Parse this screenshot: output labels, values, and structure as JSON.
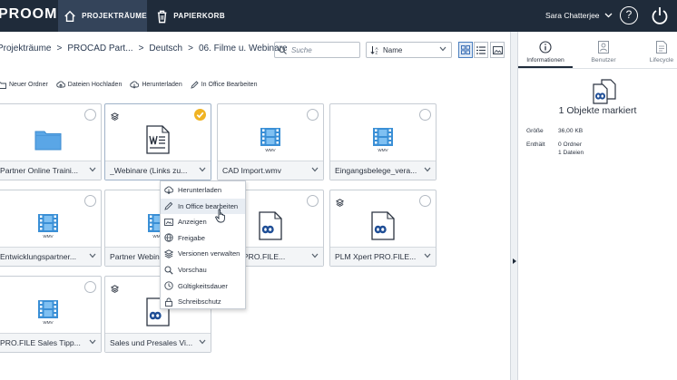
{
  "app": {
    "logo_text": "PROOM"
  },
  "topnav": {
    "tabs": [
      {
        "label": "PROJEKTRÄUME",
        "icon": "home-icon",
        "active": true
      },
      {
        "label": "PAPIERKORB",
        "icon": "trash-icon",
        "active": false
      }
    ],
    "user_name": "Sara Chatterjee",
    "help_label": "?"
  },
  "breadcrumb": [
    "Projekträume",
    "PROCAD Part...",
    "Deutsch",
    "06. Filme u. Webinare"
  ],
  "search": {
    "placeholder": "Suche"
  },
  "sort": {
    "label": "Name"
  },
  "actions": [
    {
      "label": "Neuer Ordner",
      "icon": "folder-plus-icon"
    },
    {
      "label": "Dateien Hochladen",
      "icon": "upload-icon"
    },
    {
      "label": "Herunterladen",
      "icon": "download-icon"
    },
    {
      "label": "In Office Bearbeiten",
      "icon": "pencil-icon"
    }
  ],
  "tiles": [
    {
      "name": "Partner Online Traini...",
      "type": "folder",
      "checked": false,
      "badge": false
    },
    {
      "name": "_Webinare (Links zu...",
      "type": "word",
      "checked": true,
      "badge": true
    },
    {
      "name": "CAD Import.wmv",
      "type": "wmv",
      "checked": false,
      "badge": false
    },
    {
      "name": "Eingangsbelege_vera...",
      "type": "wmv",
      "checked": false,
      "badge": false
    },
    {
      "name": "Entwicklungspartner...",
      "type": "wmv",
      "checked": false,
      "badge": false
    },
    {
      "name": "Partner Webinar...",
      "type": "wmv",
      "checked": false,
      "badge": false
    },
    {
      "name": "Xpert PRO.FILE...",
      "type": "proom",
      "checked": false,
      "badge": false
    },
    {
      "name": "PLM Xpert PRO.FILE...",
      "type": "proom",
      "checked": false,
      "badge": true
    },
    {
      "name": "PRO.FILE Sales Tipp...",
      "type": "wmv",
      "checked": false,
      "badge": false
    },
    {
      "name": "Sales und Presales Vi...",
      "type": "proom",
      "checked": false,
      "badge": true
    }
  ],
  "file_label_wmv": "WMV",
  "context_menu": [
    {
      "label": "Herunterladen",
      "icon": "download-icon"
    },
    {
      "label": "In Office bearbeiten",
      "icon": "pencil-icon",
      "highlighted": true
    },
    {
      "label": "Anzeigen",
      "icon": "view-icon"
    },
    {
      "label": "Freigabe",
      "icon": "globe-icon"
    },
    {
      "label": "Versionen verwalten",
      "icon": "layers-icon"
    },
    {
      "label": "Vorschau",
      "icon": "magnifier-icon"
    },
    {
      "label": "Gültigkeitsdauer",
      "icon": "clock-icon"
    },
    {
      "label": "Schreibschutz",
      "icon": "lock-icon"
    }
  ],
  "panel": {
    "tabs": [
      {
        "label": "Informationen",
        "icon": "info-icon",
        "active": true
      },
      {
        "label": "Benutzer",
        "icon": "user-icon",
        "active": false
      },
      {
        "label": "Lifecycle",
        "icon": "document-icon",
        "active": false
      }
    ],
    "title": "1 Objekte markiert",
    "size_label": "Größe",
    "size_value": "36,00 KB",
    "contains_label": "Enthält",
    "contains_folders": "0 Ordner",
    "contains_files": "1 Dateien"
  },
  "colors": {
    "topbar": "#1f2b3a",
    "active_tab": "#34445a",
    "accent": "#3b6fb6",
    "check": "#f0b323"
  }
}
